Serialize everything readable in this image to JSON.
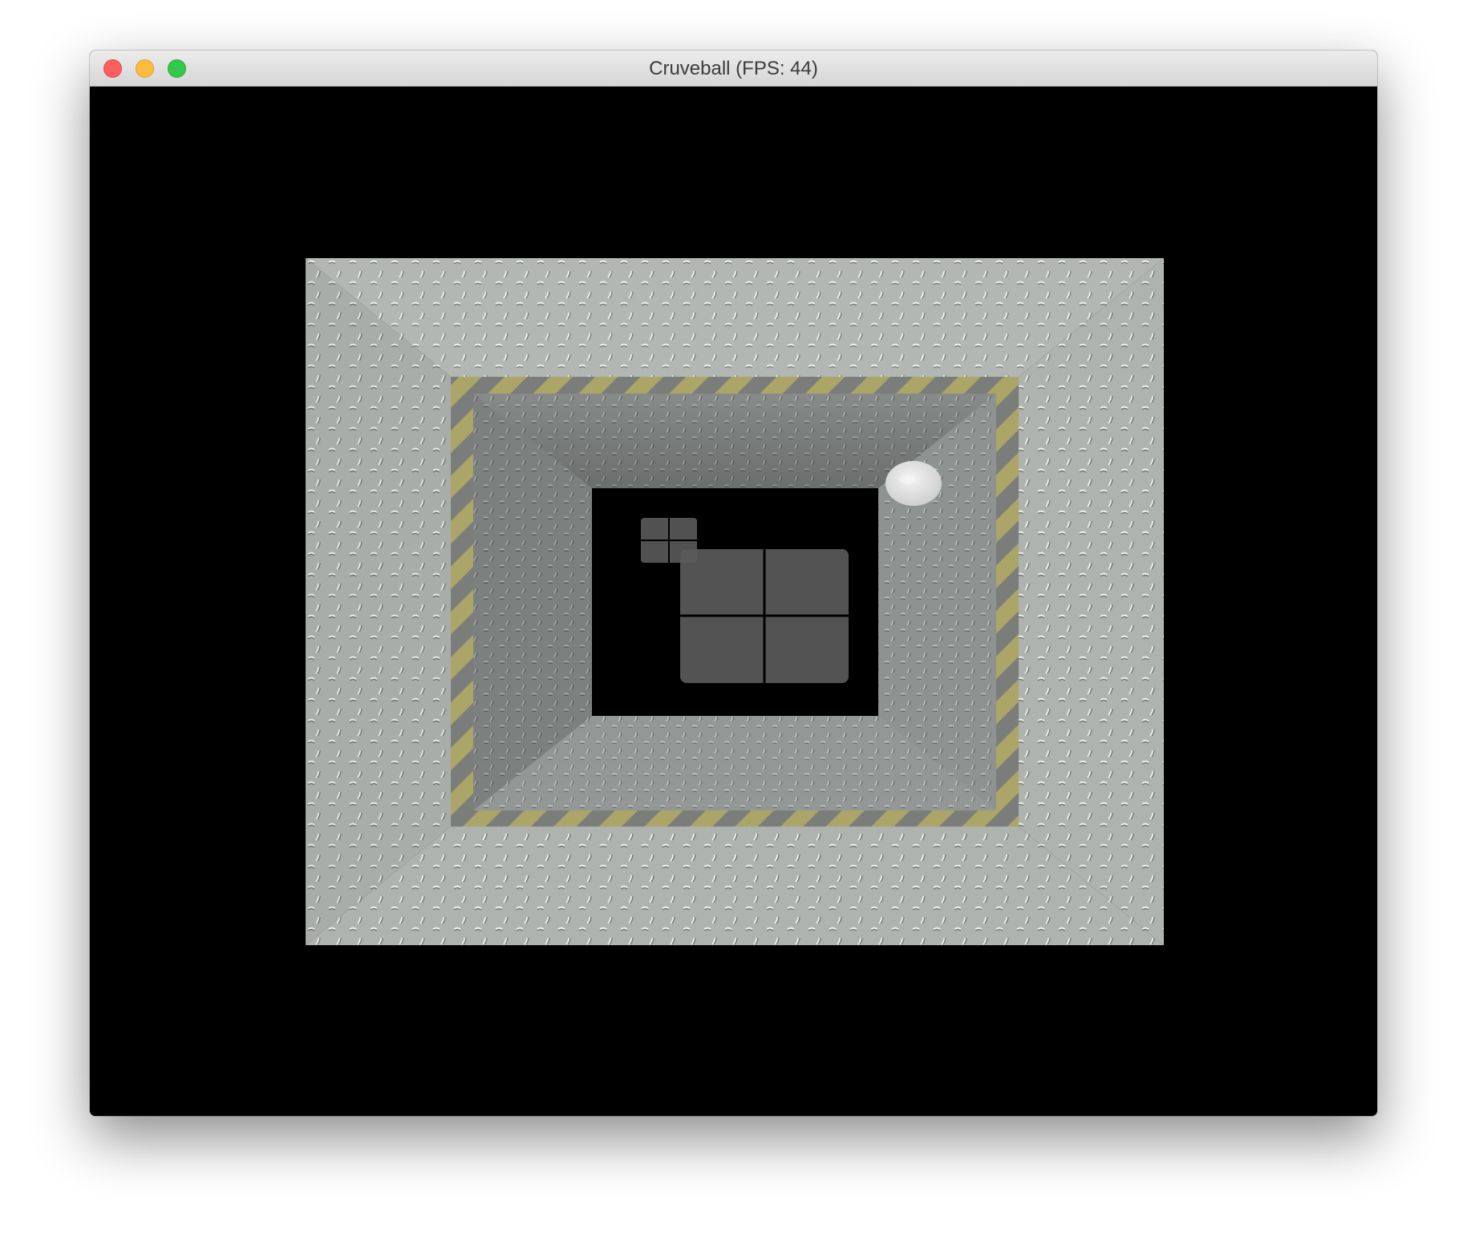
{
  "window": {
    "title": "Cruveball (FPS: 44)",
    "controls": {
      "close": "close-button",
      "minimize": "minimize-button",
      "zoom": "zoom-button"
    }
  },
  "game": {
    "name": "Cruveball",
    "fps": 44,
    "colors": {
      "background": "#000000",
      "wall_metal": "#b7bcb8",
      "hazard_yellow": "#c9c27a",
      "paddle_fill": "#5a5a5a",
      "ball": "#e6e6e6"
    },
    "icons": {
      "ball": "ball-icon",
      "player_paddle": "player-paddle",
      "opponent_paddle": "opponent-paddle"
    }
  }
}
